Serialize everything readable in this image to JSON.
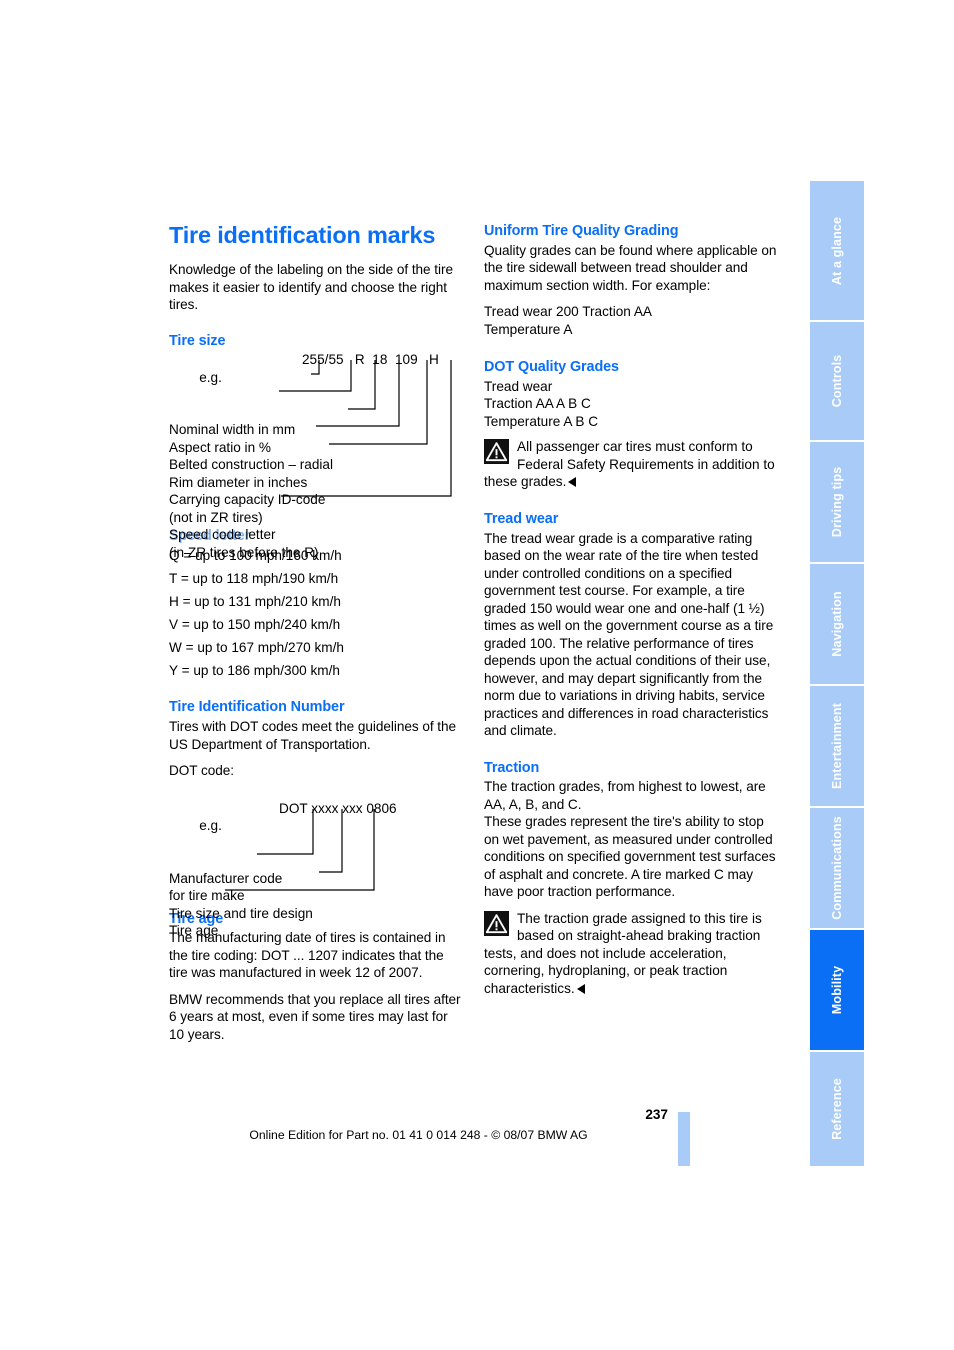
{
  "document": {
    "page_number": "237",
    "footer_text": "Online Edition for Part no. 01 41 0 014 248 - © 08/07 BMW AG"
  },
  "sidebar": {
    "tabs": [
      {
        "label": "At a glance",
        "active": false
      },
      {
        "label": "Controls",
        "active": false
      },
      {
        "label": "Driving tips",
        "active": false
      },
      {
        "label": "Navigation",
        "active": false
      },
      {
        "label": "Entertainment",
        "active": false
      },
      {
        "label": "Communications",
        "active": false
      },
      {
        "label": "Mobility",
        "active": true
      },
      {
        "label": "Reference",
        "active": false
      }
    ],
    "colors": {
      "inactive": "#a8cbf7",
      "active": "#0a6ff5",
      "label": "#ffffff"
    }
  },
  "colors": {
    "heading_blue": "#0a6ff5",
    "heading_blue_muted": "#7fb0f0",
    "body_text": "#000000"
  },
  "left_column": {
    "title": "Tire identification marks",
    "intro": "Knowledge of the labeling on the side of the tire makes it easier to identify and choose the right tires.",
    "tire_size": {
      "heading": "Tire size",
      "example_prefix": "e.g.",
      "example_code": "255/55   R  18  109   H",
      "labels": [
        "Nominal width in mm",
        "Aspect ratio in %",
        "Belted construction – radial",
        "Rim diameter in inches",
        "Carrying capacity ID-code",
        "(not in ZR tires)",
        "Speed code letter",
        "(in ZR tires before the R)"
      ]
    },
    "speed_letter": {
      "heading": "Speed letter",
      "rows": [
        "Q = up to 100 mph/160 km/h",
        "T = up to 118 mph/190 km/h",
        "H = up to 131 mph/210 km/h",
        "V = up to 150 mph/240 km/h",
        "W = up to 167 mph/270 km/h",
        "Y = up to 186 mph/300 km/h"
      ]
    },
    "tin": {
      "heading": "Tire Identification Number",
      "body": "Tires with DOT codes meet the guidelines of the US Department of Transportation.",
      "dot_code_label": "DOT code:",
      "example_prefix": "e.g.",
      "example_code": "DOT xxxx xxx 0806",
      "labels": [
        "Manufacturer code",
        "for tire make",
        "Tire size and tire design",
        "Tire age"
      ]
    },
    "tire_age": {
      "heading": "Tire age",
      "paragraph_1": "The manufacturing date of tires is contained in the tire coding: DOT ... 1207 indicates that the tire was manufactured in week 12 of 2007.",
      "paragraph_2": "BMW recommends that you replace all tires after 6 years at most, even if some tires may last for 10 years."
    }
  },
  "right_column": {
    "utqg": {
      "heading": "Uniform Tire Quality Grading",
      "body": "Quality grades can be found where applicable on the tire sidewall between tread shoulder and maximum section width. For example:",
      "example_lines": [
        "Tread wear 200 Traction AA",
        "Temperature A"
      ]
    },
    "dot_grades": {
      "heading": "DOT Quality Grades",
      "lines": [
        "Tread wear",
        "Traction AA A B C",
        "Temperature A B C"
      ],
      "note": "All passenger car tires must conform to Federal Safety Requirements in addition to these grades."
    },
    "tread_wear": {
      "heading": "Tread wear",
      "body": "The tread wear grade is a comparative rating based on the wear rate of the tire when tested under controlled conditions on a specified government test course. For example, a tire graded 150 would wear one and one-half (1 ½) times as well on the government course as a tire graded 100. The relative performance of tires depends upon the actual conditions of their use, however, and may depart significantly from the norm due to variations in driving habits, service practices and differences in road characteristics and climate."
    },
    "traction": {
      "heading": "Traction",
      "body_1": "The traction grades, from highest to lowest, are AA, A, B, and C.",
      "body_2": "These grades represent the tire's ability to stop on wet pavement, as measured under controlled conditions on specified government test surfaces of asphalt and concrete. A tire marked C may have poor traction performance.",
      "note": "The traction grade assigned to this tire is based on straight-ahead braking traction tests, and does not include acceleration, cornering, hydroplaning, or peak traction characteristics."
    }
  }
}
